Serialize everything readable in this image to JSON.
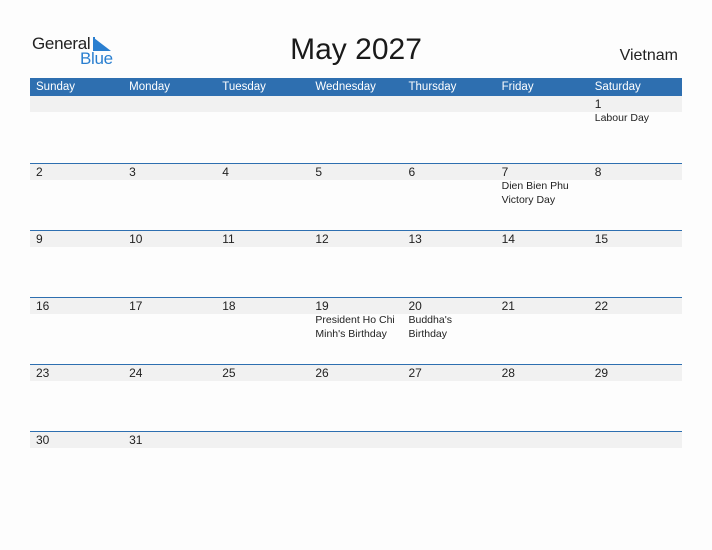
{
  "logo": {
    "word1": "General",
    "word2": "Blue"
  },
  "title": "May 2027",
  "country": "Vietnam",
  "colors": {
    "header_bg": "#2e6fb0",
    "accent_blue": "#2a7fd0",
    "day_band": "#f1f1f1"
  },
  "weekdays": [
    "Sunday",
    "Monday",
    "Tuesday",
    "Wednesday",
    "Thursday",
    "Friday",
    "Saturday"
  ],
  "weeks": [
    [
      {
        "day": "",
        "event": ""
      },
      {
        "day": "",
        "event": ""
      },
      {
        "day": "",
        "event": ""
      },
      {
        "day": "",
        "event": ""
      },
      {
        "day": "",
        "event": ""
      },
      {
        "day": "",
        "event": ""
      },
      {
        "day": "1",
        "event": "Labour Day"
      }
    ],
    [
      {
        "day": "2",
        "event": ""
      },
      {
        "day": "3",
        "event": ""
      },
      {
        "day": "4",
        "event": ""
      },
      {
        "day": "5",
        "event": ""
      },
      {
        "day": "6",
        "event": ""
      },
      {
        "day": "7",
        "event": "Dien Bien Phu Victory Day"
      },
      {
        "day": "8",
        "event": ""
      }
    ],
    [
      {
        "day": "9",
        "event": ""
      },
      {
        "day": "10",
        "event": ""
      },
      {
        "day": "11",
        "event": ""
      },
      {
        "day": "12",
        "event": ""
      },
      {
        "day": "13",
        "event": ""
      },
      {
        "day": "14",
        "event": ""
      },
      {
        "day": "15",
        "event": ""
      }
    ],
    [
      {
        "day": "16",
        "event": ""
      },
      {
        "day": "17",
        "event": ""
      },
      {
        "day": "18",
        "event": ""
      },
      {
        "day": "19",
        "event": "President Ho Chi Minh's Birthday"
      },
      {
        "day": "20",
        "event": "Buddha's Birthday"
      },
      {
        "day": "21",
        "event": ""
      },
      {
        "day": "22",
        "event": ""
      }
    ],
    [
      {
        "day": "23",
        "event": ""
      },
      {
        "day": "24",
        "event": ""
      },
      {
        "day": "25",
        "event": ""
      },
      {
        "day": "26",
        "event": ""
      },
      {
        "day": "27",
        "event": ""
      },
      {
        "day": "28",
        "event": ""
      },
      {
        "day": "29",
        "event": ""
      }
    ],
    [
      {
        "day": "30",
        "event": ""
      },
      {
        "day": "31",
        "event": ""
      },
      {
        "day": "",
        "event": ""
      },
      {
        "day": "",
        "event": ""
      },
      {
        "day": "",
        "event": ""
      },
      {
        "day": "",
        "event": ""
      },
      {
        "day": "",
        "event": ""
      }
    ]
  ]
}
